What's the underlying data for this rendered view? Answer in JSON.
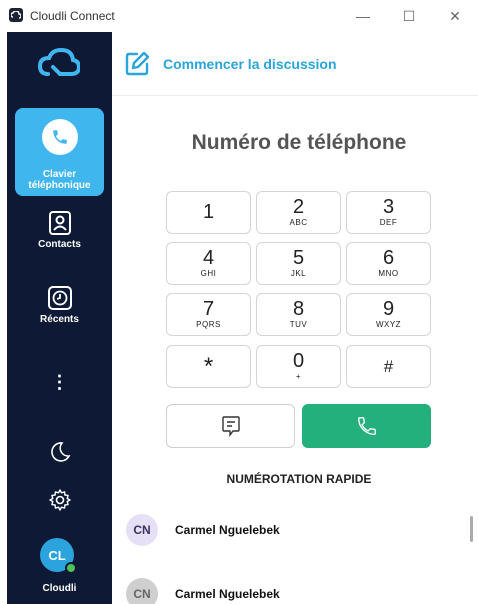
{
  "window": {
    "title": "Cloudli Connect",
    "minimize": "—",
    "maximize": "☐",
    "close": "✕"
  },
  "sidebar": {
    "items": [
      {
        "label_line1": "Clavier",
        "label_line2": "téléphonique",
        "icon": "phone-icon",
        "active": true
      },
      {
        "label": "Contacts",
        "icon": "contact-card-icon"
      },
      {
        "label": "Récents",
        "icon": "clock-icon"
      },
      {
        "label": "⋮",
        "icon": "more-vertical-icon"
      }
    ],
    "theme_icon": "moon-icon",
    "settings_icon": "gear-icon",
    "user": {
      "initials": "CL",
      "name": "Cloudli",
      "status_color": "#4cc25a"
    }
  },
  "header": {
    "action_label": "Commencer la discussion",
    "icon": "compose-icon"
  },
  "dialer": {
    "title": "Numéro de téléphone",
    "keys": [
      {
        "digit": "1",
        "letters": ""
      },
      {
        "digit": "2",
        "letters": "ABC"
      },
      {
        "digit": "3",
        "letters": "DEF"
      },
      {
        "digit": "4",
        "letters": "GHI"
      },
      {
        "digit": "5",
        "letters": "JKL"
      },
      {
        "digit": "6",
        "letters": "MNO"
      },
      {
        "digit": "7",
        "letters": "PQRS"
      },
      {
        "digit": "8",
        "letters": "TUV"
      },
      {
        "digit": "9",
        "letters": "WXYZ"
      },
      {
        "digit": "*",
        "letters": ""
      },
      {
        "digit": "0",
        "letters": "+"
      },
      {
        "digit": "#",
        "letters": ""
      }
    ],
    "message_icon": "message-icon",
    "call_icon": "phone-icon"
  },
  "speed_dial": {
    "title": "NUMÉROTATION RAPIDE",
    "contacts": [
      {
        "initials": "CN",
        "name": "Carmel Nguelebek"
      },
      {
        "initials": "CN",
        "name": "Carmel Nguelebek"
      }
    ]
  },
  "colors": {
    "sidebar_bg": "#0e1a35",
    "active_nav": "#3fb6ee",
    "accent": "#2aa4dc",
    "call_green": "#23b07d"
  }
}
